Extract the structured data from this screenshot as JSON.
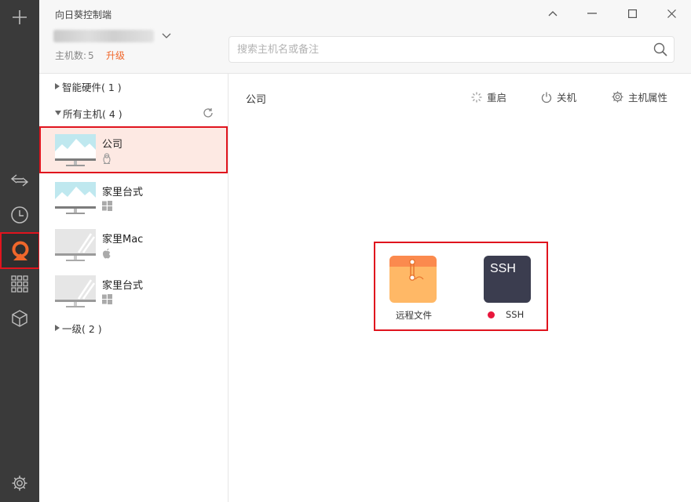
{
  "window": {
    "title": "向日葵控制端",
    "controls": [
      "chevron-up-icon",
      "minimize-icon",
      "maximize-icon",
      "close-icon"
    ]
  },
  "account": {
    "host_count_label": "主机数:",
    "host_count": "5",
    "upgrade_label": "升级"
  },
  "search": {
    "placeholder": "搜索主机名或备注",
    "value": ""
  },
  "rail": {
    "items": [
      "plus-icon",
      "remote-swap-icon",
      "history-clock-icon",
      "sunlogin-logo-icon",
      "apps-grid-icon",
      "cube-icon",
      "settings-gear-icon"
    ],
    "active": "sunlogin-logo-icon",
    "accent": "#f0672b"
  },
  "groups": {
    "smart_hw": "智能硬件( 1 )",
    "all_hosts": "所有主机( 4 )",
    "level1": "一级( 2 )"
  },
  "hosts": [
    {
      "name": "公司",
      "os": "linux-tux-icon",
      "online": true,
      "selected": true
    },
    {
      "name": "家里台式",
      "os": "windows-icon",
      "online": true
    },
    {
      "name": "家里Mac",
      "os": "apple-icon",
      "online": false
    },
    {
      "name": "家里台式",
      "os": "windows-icon",
      "online": false
    }
  ],
  "detail": {
    "title": "公司",
    "actions": {
      "restart": "重启",
      "shutdown": "关机",
      "properties": "主机属性"
    }
  },
  "tools": {
    "remote_file": "远程文件",
    "ssh_tile": "SSH",
    "ssh_label": "SSH"
  },
  "colors": {
    "highlight": "#e0141e",
    "selected_bg": "#fde9e3",
    "rail_bg": "#3a3a3a",
    "ssh_tile": "#3b3d4f",
    "file_tile": "#ffb866",
    "status_dot": "#e8163c"
  }
}
